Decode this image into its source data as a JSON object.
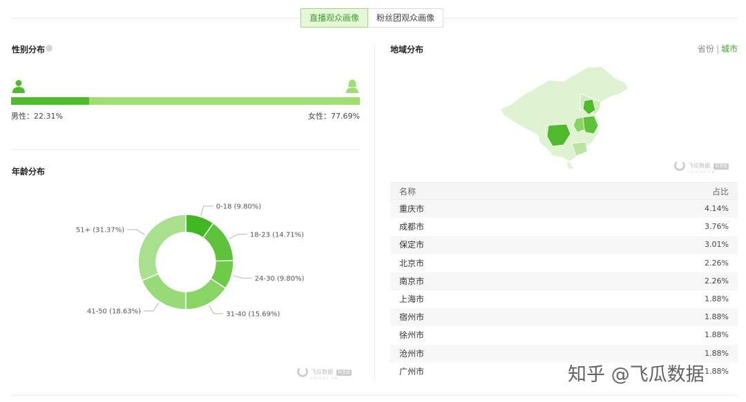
{
  "tabs": {
    "live_audience": "直播观众画像",
    "fan_group": "粉丝团观众画像"
  },
  "gender": {
    "title": "性别分布",
    "male_label": "男性：22.31%",
    "female_label": "女性：77.69%",
    "male_fraction": 0.2231,
    "colors": {
      "male": "#4fba2b",
      "female": "#9ede72"
    }
  },
  "age": {
    "title": "年龄分布"
  },
  "chart_data": {
    "type": "pie",
    "categories": [
      "0-18",
      "18-23",
      "24-30",
      "31-40",
      "41-50",
      "51+"
    ],
    "values": [
      9.8,
      14.71,
      9.8,
      15.69,
      18.63,
      31.37
    ],
    "labels": [
      "0-18 (9.80%)",
      "18-23 (14.71%)",
      "24-30 (9.80%)",
      "31-40 (15.69%)",
      "41-50 (18.63%)",
      "51+ (31.37%)"
    ],
    "colors": [
      "#40b81f",
      "#5ec33b",
      "#6ecb48",
      "#88d564",
      "#98da78",
      "#a9e08e"
    ]
  },
  "region": {
    "title": "地域分布",
    "toggle_province": "省份",
    "toggle_separator": "|",
    "toggle_city": "城市",
    "table_header": {
      "name": "名称",
      "ratio": "占比"
    },
    "rows": [
      {
        "name": "重庆市",
        "ratio": "4.14%"
      },
      {
        "name": "成都市",
        "ratio": "3.76%"
      },
      {
        "name": "保定市",
        "ratio": "3.01%"
      },
      {
        "name": "北京市",
        "ratio": "2.26%"
      },
      {
        "name": "南京市",
        "ratio": "2.26%"
      },
      {
        "name": "上海市",
        "ratio": "1.88%"
      },
      {
        "name": "宿州市",
        "ratio": "1.88%"
      },
      {
        "name": "徐州市",
        "ratio": "1.88%"
      },
      {
        "name": "沧州市",
        "ratio": "1.88%"
      },
      {
        "name": "广州市",
        "ratio": "1.88%"
      }
    ]
  },
  "watermark": {
    "brand": "飞瓜数据",
    "badge": "抖音版",
    "domain": "FEIGUA.CN",
    "zhihu": "知乎 @飞瓜数据"
  }
}
